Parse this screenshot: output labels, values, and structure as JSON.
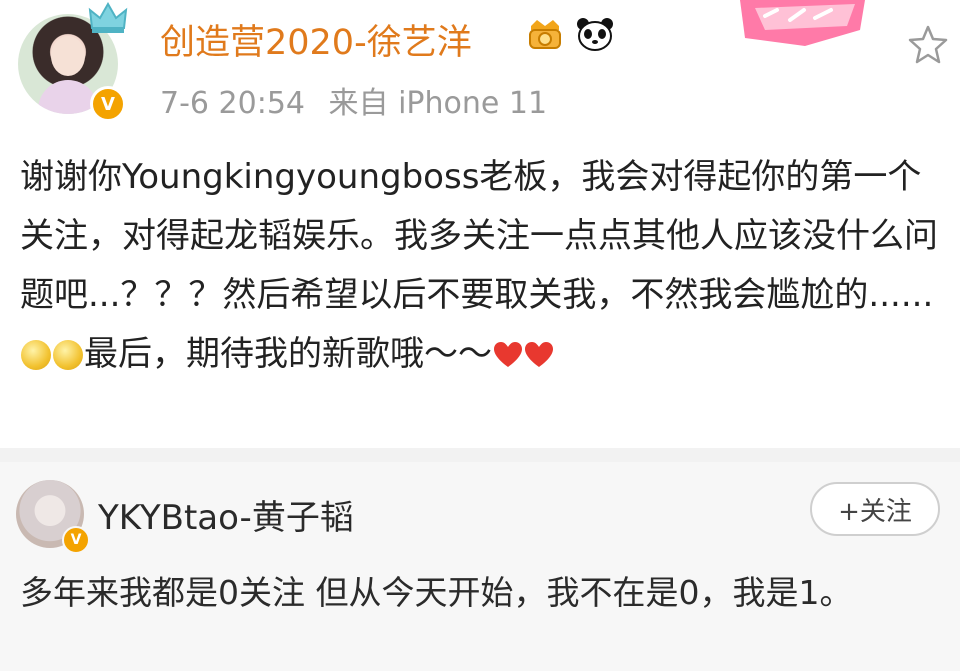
{
  "post": {
    "username": "创造营2020-徐艺洋",
    "time": "7-6 20:54",
    "source": "来自 iPhone 11",
    "verified_mark": "V",
    "text_parts": [
      "谢谢你Youngkingyoungboss老板，我会对得起你的第一个关注，对得起龙韬娱乐。我多关注一点点其他人应该没什么问题吧...？？？然后希望以后不要取关我，不然我会尴尬的......",
      "最后，期待我的新歌哦～～"
    ],
    "icons": [
      "crown-icon",
      "vip-badge-icon",
      "panda-icon",
      "star-icon",
      "smile-emoji",
      "heart-emoji"
    ],
    "colors": {
      "username": "#e07a1c",
      "verified": "#f4a300",
      "heart": "#e8382f"
    }
  },
  "repost": {
    "username": "YKYBtao-黄子韬",
    "verified_mark": "V",
    "follow_label": "+关注",
    "text": "多年来我都是0关注 但从今天开始，我不在是0，我是1。"
  }
}
